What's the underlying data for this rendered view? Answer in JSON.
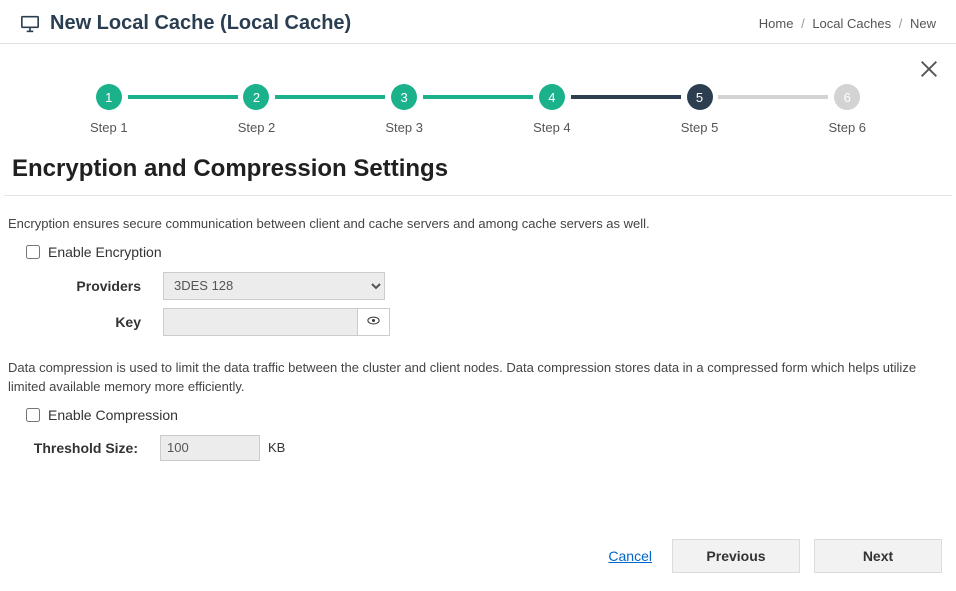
{
  "header": {
    "title": "New Local Cache (Local Cache)"
  },
  "breadcrumb": {
    "home": "Home",
    "caches": "Local Caches",
    "new": "New"
  },
  "stepper": {
    "steps": [
      {
        "num": "1",
        "label": "Step 1"
      },
      {
        "num": "2",
        "label": "Step 2"
      },
      {
        "num": "3",
        "label": "Step 3"
      },
      {
        "num": "4",
        "label": "Step 4"
      },
      {
        "num": "5",
        "label": "Step 5"
      },
      {
        "num": "6",
        "label": "Step 6"
      }
    ]
  },
  "section": {
    "title": "Encryption and Compression Settings"
  },
  "encryption": {
    "desc": "Encryption ensures secure communication between client and cache servers and among cache servers as well.",
    "enable_label": "Enable Encryption",
    "providers_label": "Providers",
    "providers_value": "3DES 128",
    "key_label": "Key",
    "key_value": ""
  },
  "compression": {
    "desc": "Data compression is used to limit the data traffic between the cluster and client nodes. Data compression stores data in a compressed form which helps utilize limited available memory more efficiently.",
    "enable_label": "Enable Compression",
    "threshold_label": "Threshold Size:",
    "threshold_value": "100",
    "threshold_unit": "KB"
  },
  "footer": {
    "cancel": "Cancel",
    "previous": "Previous",
    "next": "Next"
  }
}
